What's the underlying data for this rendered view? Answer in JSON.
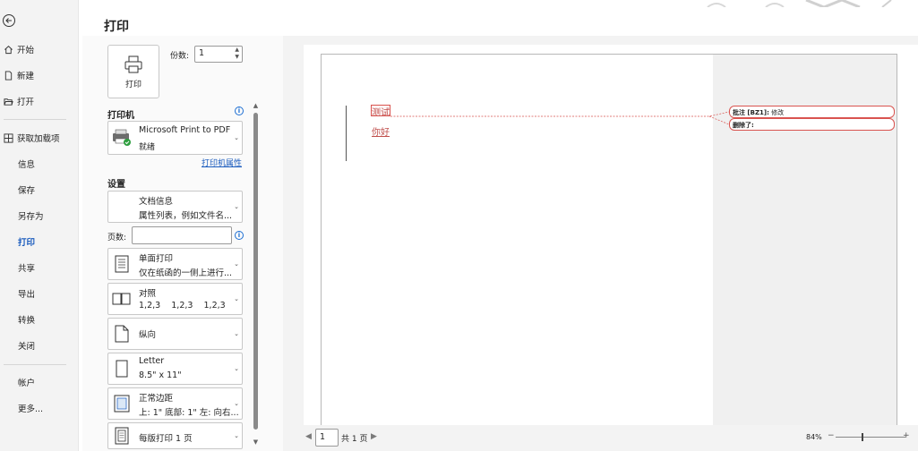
{
  "nav": {
    "items": [
      {
        "label": "开始",
        "icon": "home-icon"
      },
      {
        "label": "新建",
        "icon": "new-document-icon"
      },
      {
        "label": "打开",
        "icon": "open-folder-icon"
      },
      {
        "label": "获取加载项",
        "icon": "addins-icon"
      },
      {
        "label": "信息"
      },
      {
        "label": "保存"
      },
      {
        "label": "另存为"
      },
      {
        "label": "打印",
        "active": true
      },
      {
        "label": "共享"
      },
      {
        "label": "导出"
      },
      {
        "label": "转换"
      },
      {
        "label": "关闭"
      },
      {
        "label": "帐户"
      },
      {
        "label": "更多..."
      }
    ]
  },
  "page_title": "打印",
  "print_button_label": "打印",
  "copies": {
    "label": "份数:",
    "value": "1"
  },
  "printer": {
    "section_label": "打印机",
    "name": "Microsoft Print to PDF",
    "status": "就绪",
    "properties_link": "打印机属性"
  },
  "settings": {
    "section_label": "设置",
    "doc_info": {
      "line1": "文档信息",
      "line2": "属性列表，例如文件名..."
    },
    "pages_label": "页数:",
    "pages_value": "",
    "sides": {
      "line1": "单面打印",
      "line2": "仅在纸函的一侧上进行..."
    },
    "collate": {
      "line1": "对照",
      "line2": "1,2,3    1,2,3    1,2,3"
    },
    "orientation": {
      "line1": "纵向"
    },
    "paper": {
      "line1": "Letter",
      "line2": "8.5\" x 11\""
    },
    "margins": {
      "line1": "正常边距",
      "line2": "上: 1\" 底部: 1\" 左: 向右..."
    },
    "per_sheet": {
      "line1": "每版打印 1 页"
    }
  },
  "preview": {
    "text1": "测试",
    "text2": "你好",
    "comment1": {
      "label": "批注 [BZ1]:",
      "text": "修改"
    },
    "comment2": {
      "label": "删除了:",
      "text": ""
    }
  },
  "footer": {
    "page_value": "1",
    "page_total": "共 1 页",
    "zoom": "84%"
  },
  "colors": {
    "accent": "#185abd",
    "revision": "#c0504d",
    "balloon_border": "#d9534f"
  }
}
